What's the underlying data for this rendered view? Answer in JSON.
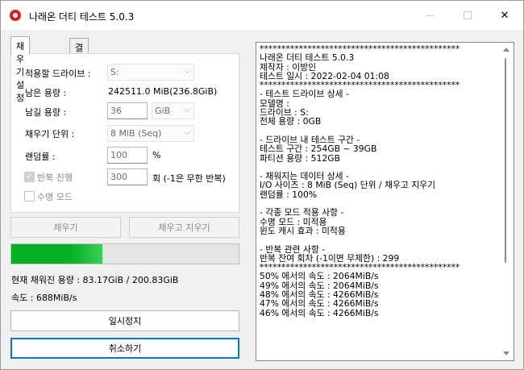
{
  "window": {
    "title": "나래온 더티 테스트 5.0.3"
  },
  "tabs": [
    {
      "label": "채우기 설정"
    },
    {
      "label": "결과 호환성"
    }
  ],
  "settings": {
    "drive_label": "적용할 드라이브 :",
    "drive_value": "S:",
    "remaining_label": "남은 용량 :",
    "remaining_value": "242511.0 MiB(236.8GiB)",
    "leave_label": "남길 용량 :",
    "leave_value": "36",
    "leave_unit": "GiB",
    "unit_label": "채우기 단위 :",
    "unit_value": "8 MiB (Seq)",
    "random_label": "랜덤률 :",
    "random_value": "100",
    "random_suffix": "%",
    "repeat_label": "반복 진행",
    "repeat_value": "300",
    "repeat_suffix": "회 (-1은 무한 반복)",
    "lifetime_label": "수명 모드"
  },
  "buttons": {
    "fill": "채우기",
    "fill_and_erase": "채우고 지우기",
    "pause": "일시정지",
    "cancel": "취소하기"
  },
  "progress": {
    "fraction": 0.4
  },
  "status": {
    "filled": "현재 채워진 용량 : 83.17GiB / 200.83GiB",
    "speed": "속도 : 688MiB/s"
  },
  "log": [
    "**********************************************",
    "나래온 더티 테스트 5.0.3",
    "제작자 : 이방인",
    "테스트 일시 : 2022-02-04 01:08",
    "**********************************************",
    "- 테스트 드라이브 상세 -",
    "모델명 :",
    "드라이브 : S:",
    "전체 용량 : 0GB",
    "",
    "- 드라이브 내 테스트 구간 -",
    "테스트 구간 : 254GB ~ 39GB",
    "파티션 용량 : 512GB",
    "",
    "- 채워지는 데이터 상세 -",
    "I/O 사이즈 : 8 MiB (Seq) 단위 / 채우고 지우기",
    "랜덤률 : 100%",
    "",
    "- 각종 모드 적용 사항 -",
    "수명 모드 : 미적용",
    "윈도 캐시 효과 : 미적용",
    "",
    "- 반복 관련 사항 -",
    "반복 잔여 회차 (-1이면 무제한) : 299",
    "**********************************************",
    "50% 에서의 속도 : 2064MiB/s",
    "49% 에서의 속도 : 2064MiB/s",
    "48% 에서의 속도 : 4266MiB/s",
    "47% 에서의 속도 : 4266MiB/s",
    "46% 에서의 속도 : 4266MiB/s"
  ]
}
